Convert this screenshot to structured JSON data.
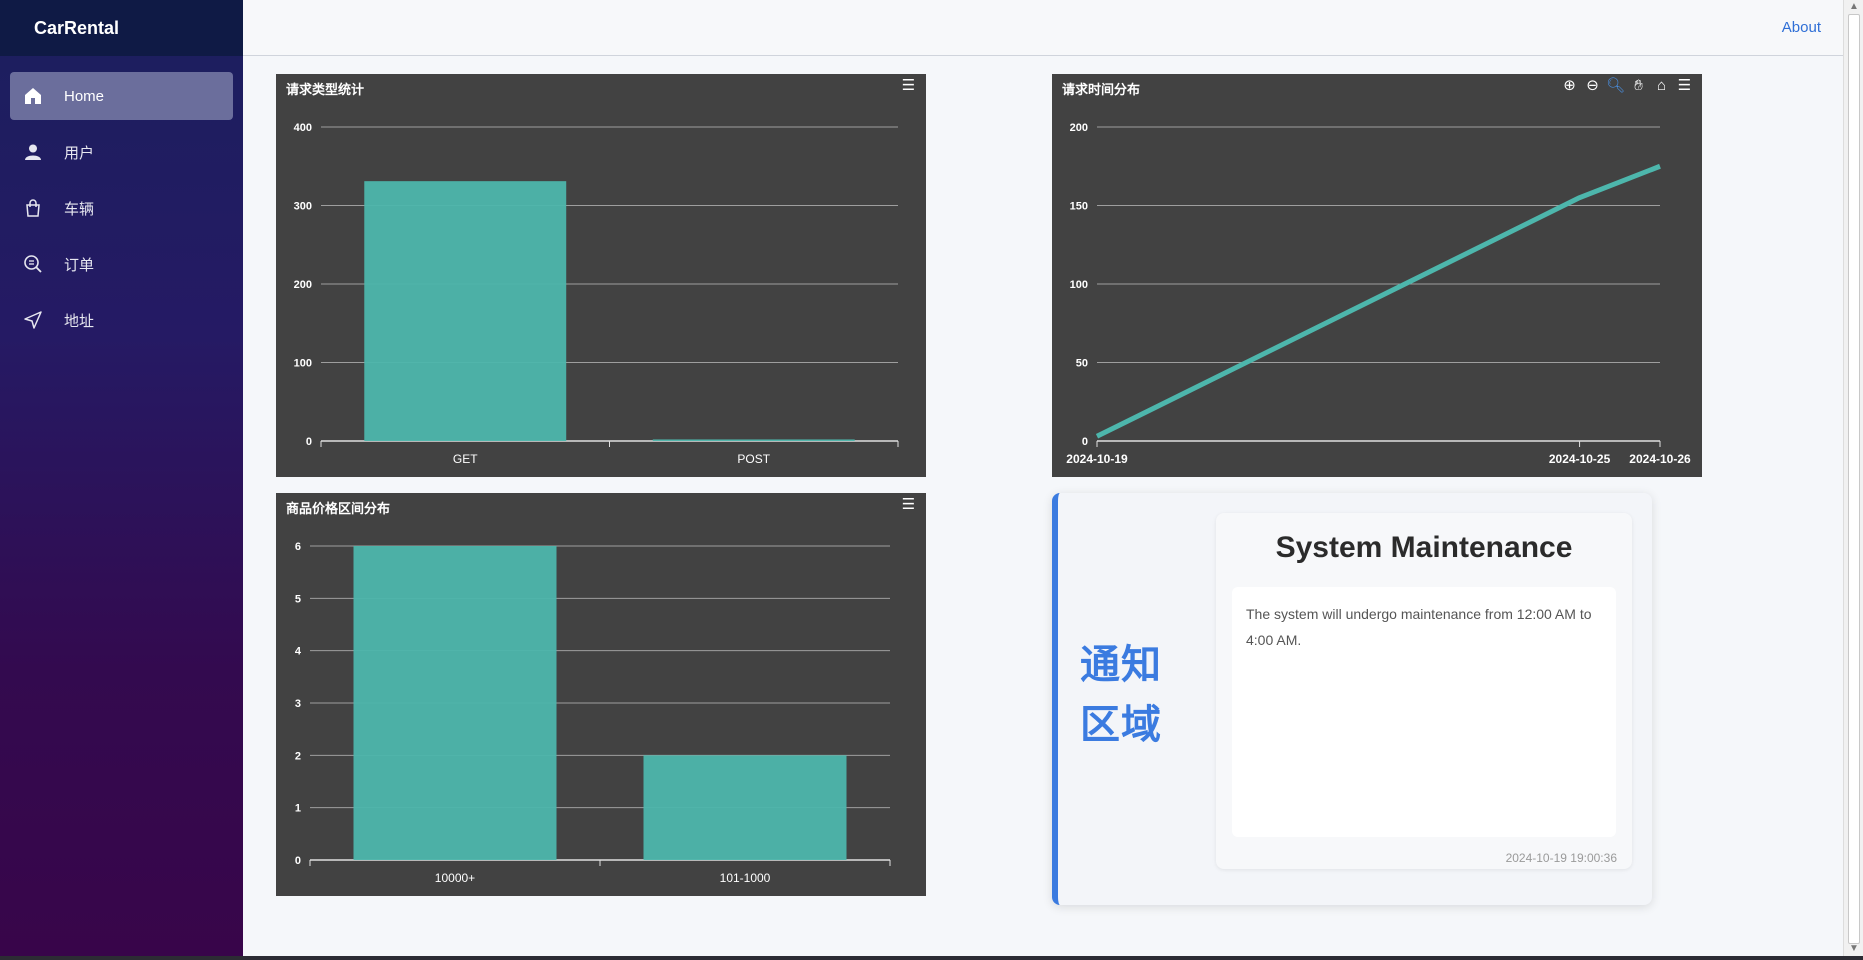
{
  "app": {
    "brand": "CarRental"
  },
  "topbar": {
    "about": "About"
  },
  "sidebar": {
    "items": [
      {
        "label": "Home",
        "icon": "home-icon",
        "active": true
      },
      {
        "label": "用户",
        "icon": "user-icon",
        "active": false
      },
      {
        "label": "车辆",
        "icon": "bag-icon",
        "active": false
      },
      {
        "label": "订单",
        "icon": "search-document-icon",
        "active": false
      },
      {
        "label": "地址",
        "icon": "location-arrow-icon",
        "active": false
      }
    ]
  },
  "colors": {
    "series": "#4db6ac",
    "chart_bg": "#424242",
    "accent": "#3b7be0"
  },
  "chart_data": [
    {
      "type": "bar",
      "title": "请求类型统计",
      "categories": [
        "GET",
        "POST"
      ],
      "values": [
        331,
        2
      ],
      "ylim": [
        0,
        400
      ],
      "yticks": [
        0,
        100,
        200,
        300,
        400
      ],
      "grid": true
    },
    {
      "type": "line",
      "title": "请求时间分布",
      "x": [
        "2024-10-19",
        "2024-10-25",
        "2024-10-26"
      ],
      "values": [
        3,
        155,
        175
      ],
      "ylim": [
        0,
        200
      ],
      "yticks": [
        0,
        50,
        100,
        150,
        200
      ],
      "grid": true
    },
    {
      "type": "bar",
      "title": "商品价格区间分布",
      "categories": [
        "10000+",
        "101-1000"
      ],
      "values": [
        6,
        2
      ],
      "ylim": [
        0,
        6
      ],
      "yticks": [
        0,
        1,
        2,
        3,
        4,
        5,
        6
      ],
      "grid": true
    }
  ],
  "notice": {
    "label": "通知区域",
    "label_lines": [
      "通知",
      "区域"
    ],
    "title": "System Maintenance",
    "body": "The system will undergo maintenance from 12:00 AM to 4:00 AM.",
    "date": "2024-10-19 19:00:36"
  }
}
